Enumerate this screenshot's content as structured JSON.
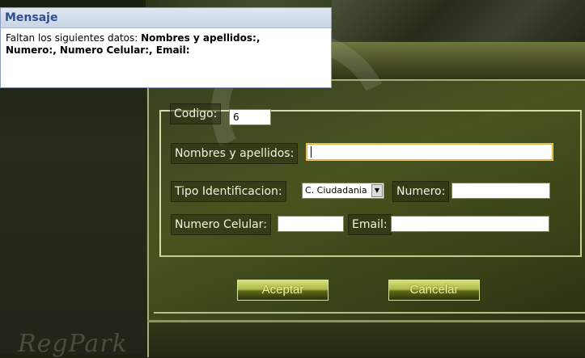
{
  "popup": {
    "title": "Mensaje",
    "message_prefix": "Faltan los siguientes datos: ",
    "message_fields_line1": "Nombres y apellidos:,",
    "message_fields_line2": "Numero:, Numero Celular:, Email:"
  },
  "background": {
    "watermark": "RegPark"
  },
  "form": {
    "codigo_label": "Codigo:",
    "codigo_value": "6",
    "nombres_label": "Nombres y apellidos:",
    "nombres_value": "",
    "tipo_id_label": "Tipo Identificacion:",
    "tipo_id_value": "C. Ciudadania",
    "numero_label": "Numero:",
    "numero_value": "",
    "celular_label": "Numero Celular:",
    "celular_value": "",
    "email_label": "Email:",
    "email_value": ""
  },
  "buttons": {
    "accept": "Aceptar",
    "cancel": "Cancelar"
  },
  "icons": {
    "select_arrow": "chevron-down-icon"
  }
}
